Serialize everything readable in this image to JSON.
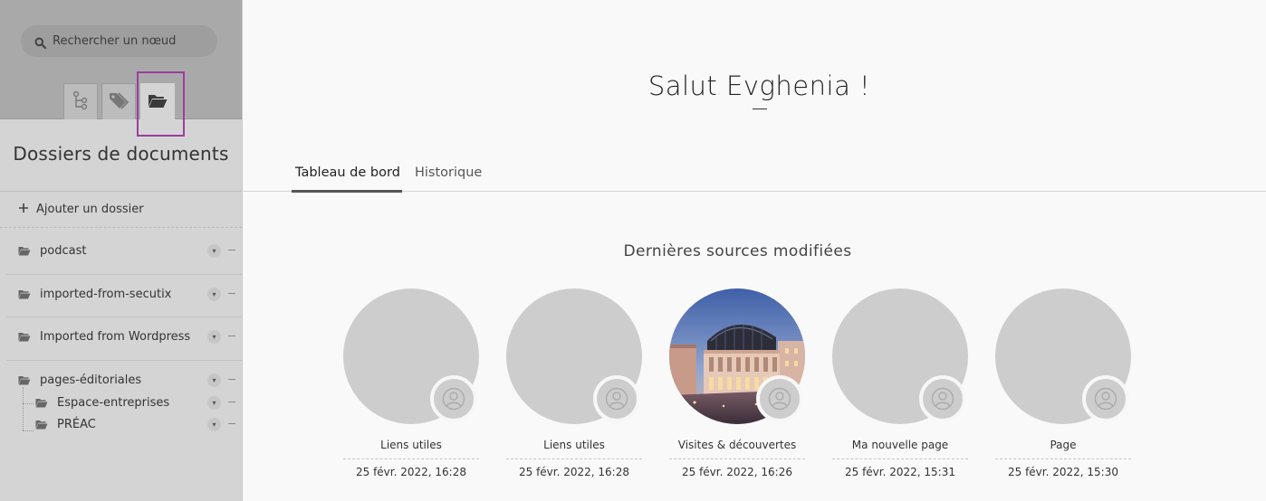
{
  "sidebar": {
    "search_placeholder": "Rechercher un nœud",
    "title": "Dossiers de documents",
    "add_folder_label": "Ajouter un dossier",
    "folders": [
      {
        "label": "podcast"
      },
      {
        "label": "imported-from-secutix"
      },
      {
        "label": "Imported from Wordpress"
      },
      {
        "label": "pages-éditoriales",
        "children": [
          {
            "label": "Espace-entreprises"
          },
          {
            "label": "PRÉAC"
          }
        ]
      }
    ]
  },
  "main": {
    "greeting": "Salut Evghenia !",
    "tabs": [
      {
        "label": "Tableau de bord",
        "active": true
      },
      {
        "label": "Historique",
        "active": false
      }
    ],
    "section_title": "Dernières sources modifiées",
    "cards": [
      {
        "name": "Liens utiles",
        "date": "25 févr. 2022, 16:28"
      },
      {
        "name": "Liens utiles",
        "date": "25 févr. 2022, 16:28"
      },
      {
        "name": "Visites & découvertes",
        "date": "25 févr. 2022, 16:26"
      },
      {
        "name": "Ma nouvelle page",
        "date": "25 févr. 2022, 15:31"
      },
      {
        "name": "Page",
        "date": "25 févr. 2022, 15:30"
      }
    ]
  },
  "colors": {
    "sidebar_top": "#a9a9a9",
    "sidebar": "#d4d4d4",
    "highlight": "#9a3d9e",
    "background": "#f9f9f9"
  }
}
